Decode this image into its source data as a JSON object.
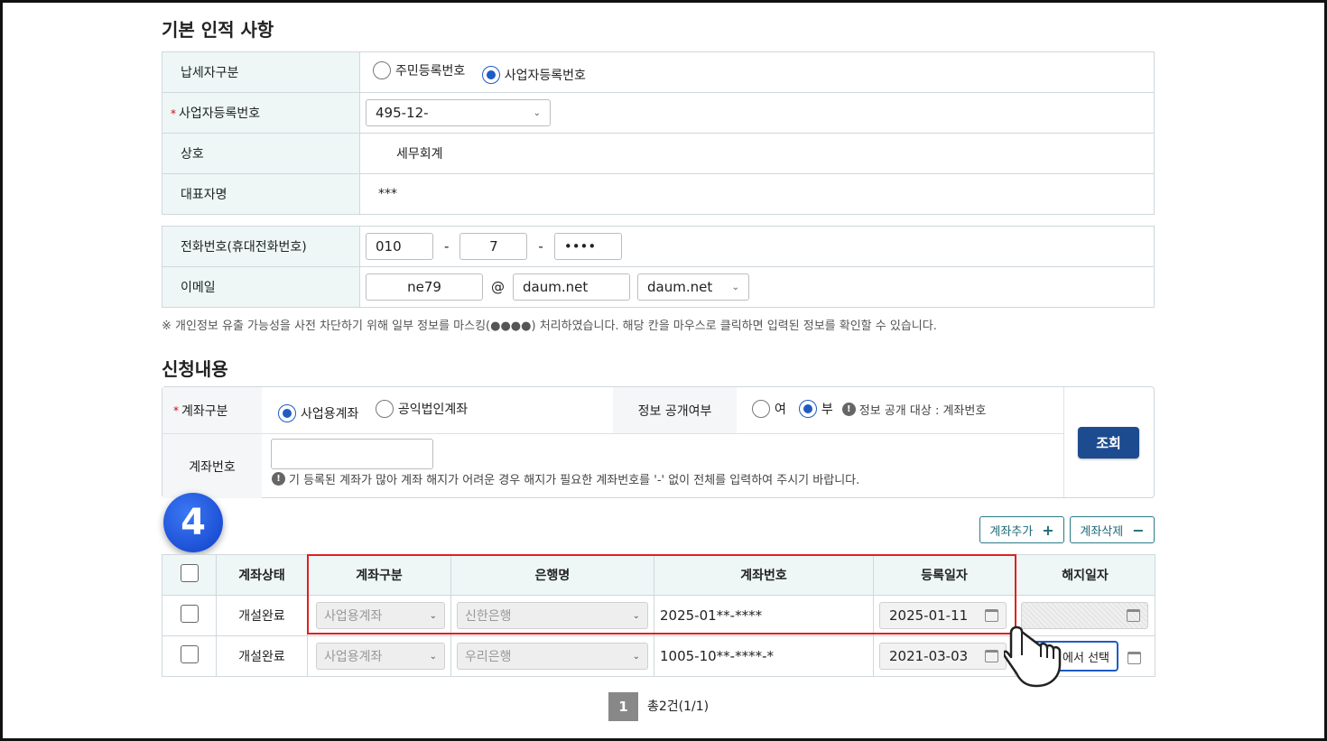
{
  "basic": {
    "title": "기본 인적 사항",
    "taxpayer_type": {
      "label": "납세자구분",
      "options": [
        "주민등록번호",
        "사업자등록번호"
      ],
      "selected": "사업자등록번호"
    },
    "business_no": {
      "label": "사업자등록번호",
      "value": "495-12-"
    },
    "company": {
      "label": "상호",
      "value": "세무회계"
    },
    "representative": {
      "label": "대표자명",
      "value": "***"
    },
    "phone": {
      "label": "전화번호(휴대전화번호)",
      "p1": "010",
      "p2": "7",
      "p3": "••••",
      "sep": "-"
    },
    "email": {
      "label": "이메일",
      "id": "ne79",
      "at": "@",
      "domain": "daum.net",
      "domain_select": "daum.net"
    },
    "notice": "※ 개인정보 유출 가능성을 사전 차단하기 위해 일부 정보를 마스킹(●●●●) 처리하였습니다. 해당 칸을 마우스로 클릭하면 입력된 정보를 확인할 수 있습니다."
  },
  "apply": {
    "title": "신청내용",
    "account_type": {
      "label": "계좌구분",
      "options": [
        "사업용계좌",
        "공익법인계좌"
      ],
      "selected": "사업용계좌"
    },
    "disclosure": {
      "label": "정보 공개여부",
      "options": [
        "여",
        "부"
      ],
      "selected": "부",
      "info": "정보 공개 대상 : 계좌번호"
    },
    "account_no": {
      "label": "계좌번호",
      "value": "",
      "hint": "기 등록된 계좌가 많아 계좌 해지가 어려운 경우 해지가 필요한 계좌번호를 '-' 없이 전체를 입력하여 주시기 바랍니다."
    },
    "search_btn": "조회"
  },
  "step_badge": "4",
  "actions": {
    "add": "계좌추가",
    "add_sym": "+",
    "delete": "계좌삭제",
    "delete_sym": "−"
  },
  "grid": {
    "headers": [
      "계좌상태",
      "계좌구분",
      "은행명",
      "계좌번호",
      "등록일자",
      "해지일자"
    ],
    "rows": [
      {
        "status": "개설완료",
        "type": "사업용계좌",
        "bank": "신한은행",
        "account": "2025-01**-****",
        "reg_date": "2025-01-11",
        "term_date": ""
      },
      {
        "status": "개설완료",
        "type": "사업용계좌",
        "bank": "우리은행",
        "account": "1005-10**-****-*",
        "reg_date": "2021-03-03",
        "term_date": "에서 선택"
      }
    ]
  },
  "pagination": {
    "page": "1",
    "total": "총2건(1/1)"
  },
  "colors": {
    "label_bg": "#eef7f6",
    "accent_blue": "#1f5bc4",
    "navy_button": "#1c4b8f",
    "highlight_red": "#e02020"
  },
  "icons": [
    "chevron-down-icon",
    "calendar-icon",
    "info-icon",
    "hand-pointer-icon",
    "plus-icon",
    "minus-icon"
  ]
}
